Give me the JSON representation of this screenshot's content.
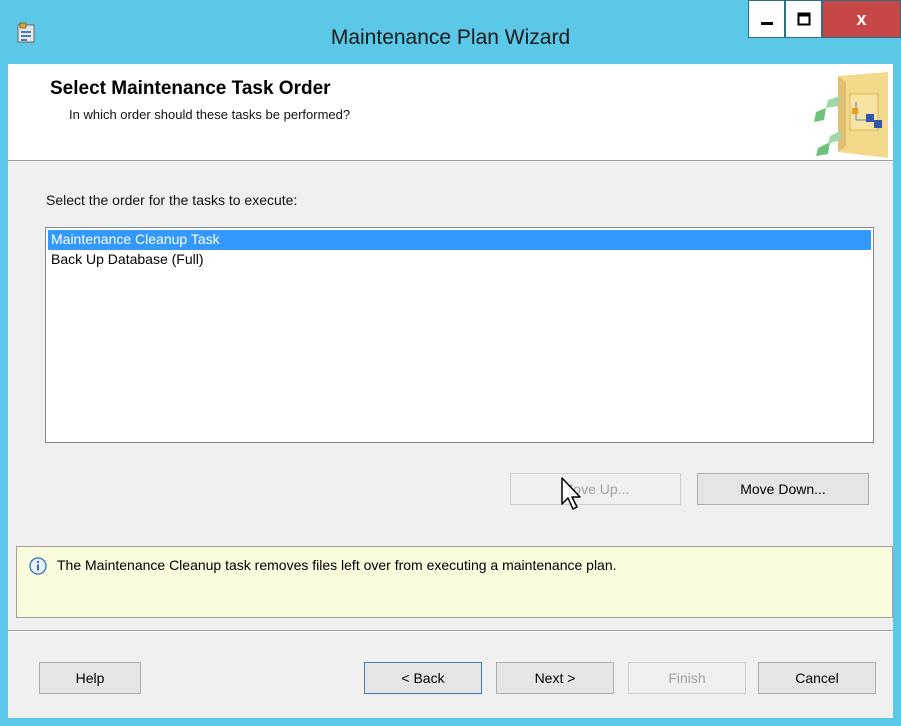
{
  "window": {
    "title": "Maintenance Plan Wizard",
    "controls": {
      "minimize_icon": "minimize-icon",
      "maximize_icon": "maximize-icon",
      "close_label": "x"
    }
  },
  "header": {
    "title": "Select Maintenance Task Order",
    "subtitle": "In which order should these tasks be performed?"
  },
  "instructions": "Select the order for the tasks to execute:",
  "task_list": {
    "items": [
      {
        "label": "Maintenance Cleanup Task",
        "selected": true
      },
      {
        "label": "Back Up Database (Full)",
        "selected": false
      }
    ]
  },
  "order_buttons": {
    "move_up": {
      "label": "Move Up...",
      "enabled": false
    },
    "move_down": {
      "label": "Move Down...",
      "enabled": true
    }
  },
  "info": {
    "icon": "info-icon",
    "text": "The Maintenance Cleanup task removes files left over from executing a maintenance plan."
  },
  "footer": {
    "help": "Help",
    "back": "< Back",
    "next": "Next >",
    "finish": "Finish",
    "cancel": "Cancel"
  },
  "colors": {
    "titlebar": "#5bc8e8",
    "selection": "#3399ff",
    "close_button": "#c74646",
    "info_background": "#fbfbdd"
  }
}
